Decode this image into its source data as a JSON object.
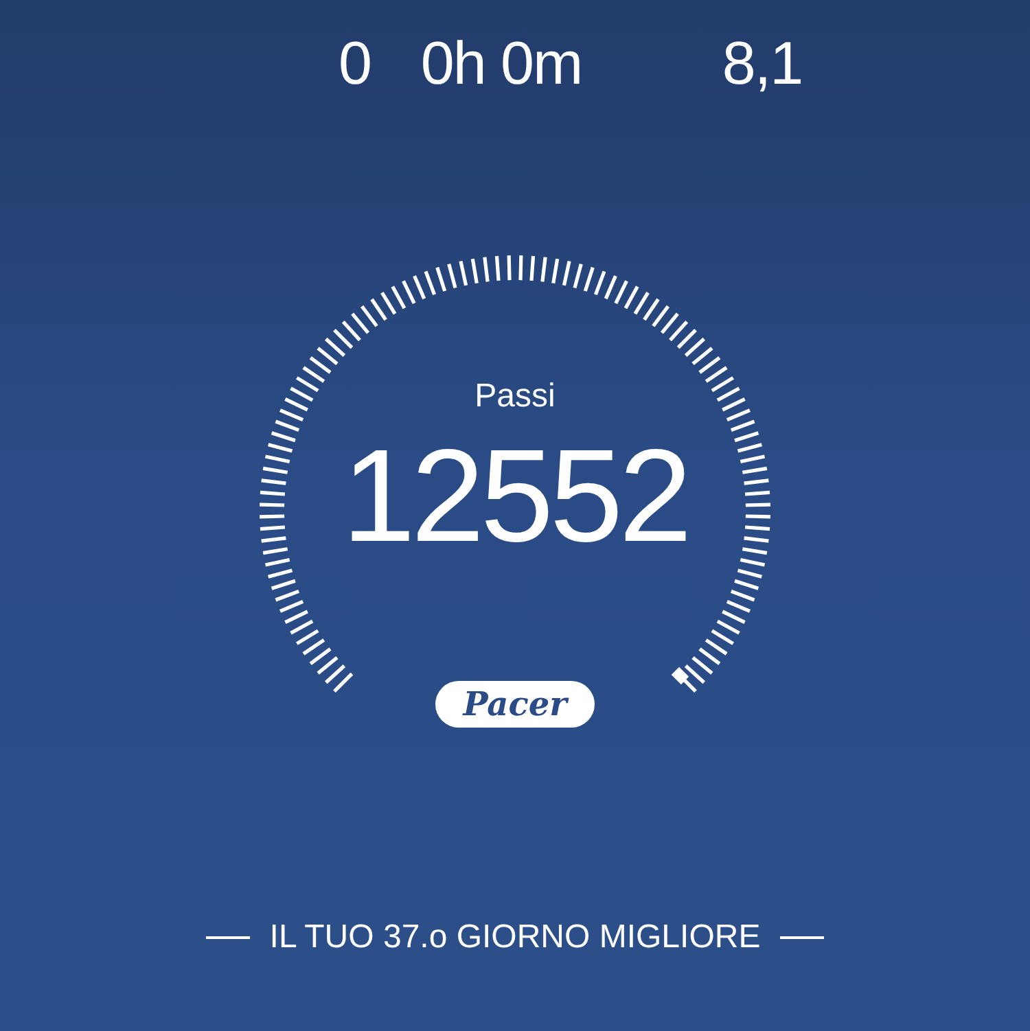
{
  "stats": [
    {
      "value": "0"
    },
    {
      "value": "0h 0m"
    },
    {
      "value": "8,1"
    }
  ],
  "gauge": {
    "label": "Passi",
    "value": "12552"
  },
  "badge": {
    "text": "Pacer"
  },
  "footer": {
    "text": "IL TUO 37.o GIORNO MIGLIORE"
  }
}
